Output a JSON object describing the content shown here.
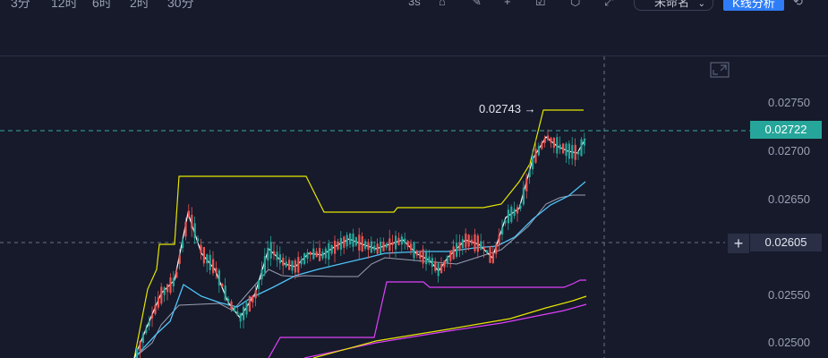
{
  "toolbar": {
    "timeframes": [
      "3分",
      "12时",
      "6时",
      "2时",
      "30分"
    ],
    "interval_label": "3s",
    "layout_name": "未命名",
    "kline_button": "K线分析"
  },
  "chart": {
    "price_axis": [
      "0.02750",
      "0.02700",
      "0.02650",
      "0.02550",
      "0.02500"
    ],
    "current_price": "0.02722",
    "crosshair_price": "0.02605",
    "high_annotation": "0.02743 →",
    "colors": {
      "background": "#161a2b",
      "up": "#26a69a",
      "down": "#ef5350",
      "current_price_tag": "#26a69a",
      "crosshair_tag": "#2a2f45",
      "donchian": "#e6e600",
      "ma_fast": "#ffffff",
      "ma_slow": "#4fc3f7",
      "ma_gray": "#9aa0b4",
      "envelope": "#e040fb"
    }
  }
}
